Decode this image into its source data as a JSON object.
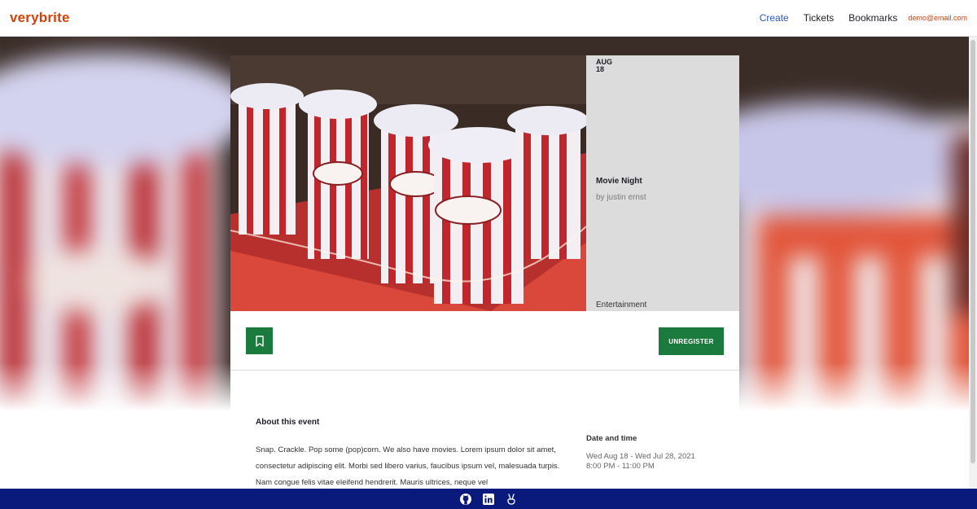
{
  "header": {
    "logo": "verybrite",
    "nav": {
      "create": "Create",
      "tickets": "Tickets",
      "bookmarks": "Bookmarks"
    },
    "email": "demo@email.com"
  },
  "event": {
    "month": "AUG",
    "day": "18",
    "title": "Movie Night",
    "organizer": "by justin ernst",
    "category": "Entertainment",
    "image_label": "Popcorn",
    "bookmark_icon": "bookmark-icon",
    "unregister_label": "UNREGISTER"
  },
  "about": {
    "heading": "About this event",
    "text": "Snap. Crackle. Pop some (pop)corn. We also have movies. Lorem ipsum dolor sit amet, consectetur adipiscing elit. Morbi sed libero varius, faucibus ipsum vel, malesuada turpis. Nam congue felis vitae eleifend hendrerit. Mauris ultrices, neque vel"
  },
  "date_time": {
    "heading": "Date and time",
    "range": "Wed Aug 18 - Wed Jul 28, 2021",
    "time": "8:00 PM - 11:00 PM"
  },
  "footer": {
    "icons": [
      "github-icon",
      "linkedin-icon",
      "angellist-icon"
    ]
  },
  "colors": {
    "brand": "#d1410c",
    "primary_button": "#1b7a3e",
    "footer": "#0a1a7c",
    "link_active": "#2d56c8"
  }
}
